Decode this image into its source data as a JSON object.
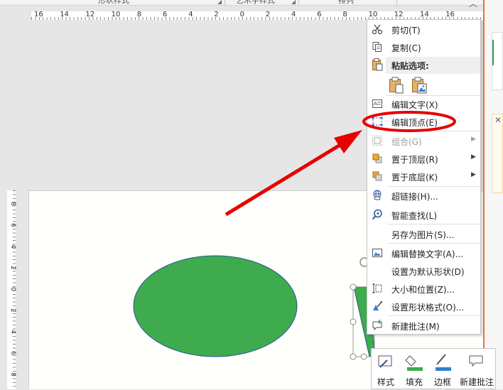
{
  "ribbon": {
    "groups": [
      "形状样式",
      "艺术字样式",
      "排列"
    ]
  },
  "ruler": {
    "h_ticks": [
      "16",
      "14",
      "12",
      "10",
      "8",
      "6",
      "4",
      "2",
      "0",
      "2",
      "4",
      "6",
      "8",
      "10",
      "12",
      "14",
      "16"
    ],
    "v_ticks": [
      "8",
      "6",
      "4",
      "2",
      "0",
      "2",
      "4",
      "6",
      "8"
    ]
  },
  "context_menu": {
    "items": [
      {
        "label": "剪切(T)",
        "icon": "scissors-icon",
        "enabled": true
      },
      {
        "label": "复制(C)",
        "icon": "copy-icon",
        "enabled": true
      },
      {
        "label": "编辑文字(X)",
        "icon": "edit-text-icon",
        "enabled": true
      },
      {
        "label": "编辑顶点(E)",
        "icon": "edit-points-icon",
        "enabled": true
      },
      {
        "label": "组合(G)",
        "icon": "group-icon",
        "enabled": false,
        "submenu": true
      },
      {
        "label": "置于顶层(R)",
        "icon": "bring-to-front-icon",
        "enabled": true,
        "submenu": true
      },
      {
        "label": "置于底层(K)",
        "icon": "send-to-back-icon",
        "enabled": true,
        "submenu": true
      },
      {
        "label": "超链接(H)...",
        "icon": "hyperlink-icon",
        "enabled": true
      },
      {
        "label": "智能查找(L)",
        "icon": "smart-lookup-icon",
        "enabled": true
      },
      {
        "label": "另存为图片(S)...",
        "icon": "",
        "enabled": true
      },
      {
        "label": "编辑替换文字(A)...",
        "icon": "alt-text-icon",
        "enabled": true
      },
      {
        "label": "设置为默认形状(D)",
        "icon": "",
        "enabled": true
      },
      {
        "label": "大小和位置(Z)...",
        "icon": "size-position-icon",
        "enabled": true
      },
      {
        "label": "设置形状格式(O)...",
        "icon": "format-shape-icon",
        "enabled": true
      },
      {
        "label": "新建批注(M)",
        "icon": "new-comment-icon",
        "enabled": true
      }
    ],
    "paste_header": "粘贴选项:"
  },
  "mini_toolbar": {
    "style_label": "样式",
    "fill_label": "填充",
    "border_label": "边框",
    "comment_label": "新建批注"
  },
  "colors": {
    "shape_fill": "#3dab4e",
    "shape_outline": "#2f5597",
    "accent": "#e8733a",
    "annotation": "#e60000"
  }
}
